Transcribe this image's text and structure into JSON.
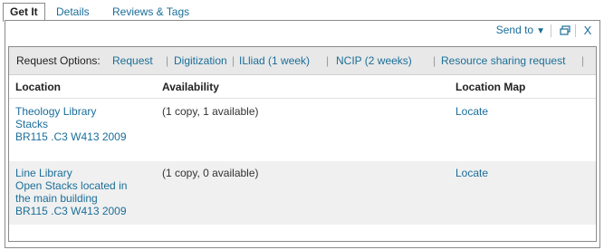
{
  "tabs": [
    {
      "label": "Get It",
      "active": true
    },
    {
      "label": "Details",
      "active": false
    },
    {
      "label": "Reviews & Tags",
      "active": false
    }
  ],
  "toolbar": {
    "send_to": "Send to",
    "popout_icon": "new-window-icon",
    "close_icon": "close-icon",
    "close_glyph": "X"
  },
  "request_options": {
    "label": "Request Options:",
    "links": [
      "Request",
      "Digitization",
      "ILliad (1 week)",
      "NCIP (2 weeks)",
      "Resource sharing request"
    ],
    "separator": "|"
  },
  "columns": [
    "Location",
    "Availability",
    "Location Map"
  ],
  "rows": [
    {
      "location_lines": [
        "Theology Library",
        "Stacks",
        "BR115 .C3 W413 2009"
      ],
      "availability": "(1 copy, 1 available)",
      "map_link": "Locate"
    },
    {
      "location_lines": [
        "Line Library",
        "Open Stacks located in",
        "the main building",
        "BR115 .C3 W413 2009"
      ],
      "availability": "(1 copy, 0 available)",
      "map_link": "Locate"
    }
  ],
  "colors": {
    "link": "#1a6e99",
    "alt_row": "#f0f0f0",
    "request_bar": "#e8e8e8"
  }
}
